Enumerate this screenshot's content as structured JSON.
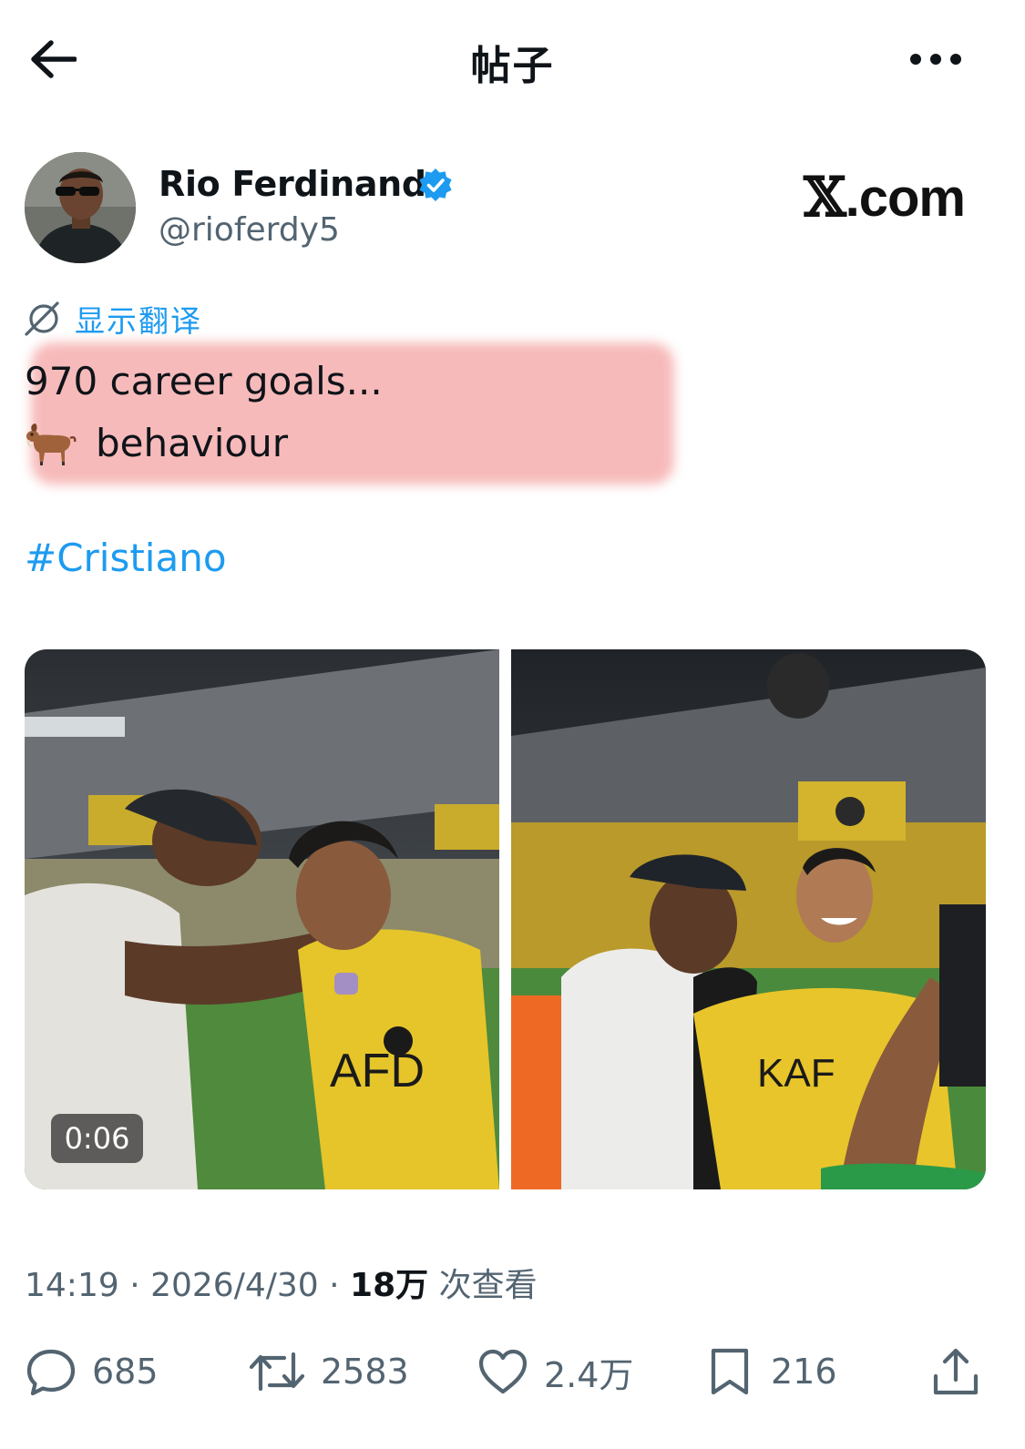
{
  "header": {
    "title": "帖子",
    "back_icon": "arrow-left-icon",
    "more_icon": "more-horizontal-icon"
  },
  "author": {
    "display_name": "Rio Ferdinand",
    "handle": "@rioferdy5",
    "verified": true,
    "verified_color": "#1d9bf0"
  },
  "brand": {
    "x_glyph": "𝕏",
    "domain": ".com"
  },
  "translate": {
    "label": "显示翻译",
    "icon": "translate-icon"
  },
  "tweet": {
    "line1": "970 career goals...",
    "line2": "behaviour",
    "emoji_icon": "goat-icon",
    "hashtag": "#Cristiano",
    "highlight_color": "#f4a0a0"
  },
  "media": {
    "video_duration": "0:06",
    "left_alt_icon": "video-thumbnail",
    "right_alt_icon": "photo-thumbnail"
  },
  "meta": {
    "time": "14:19",
    "separator": " · ",
    "date": "2026/4/30",
    "views_count": "18万",
    "views_label": " 次查看"
  },
  "actions": {
    "replies": "685",
    "reposts": "2583",
    "likes": "2.4万",
    "bookmarks": "216"
  },
  "colors": {
    "accent": "#1d9bf0",
    "secondary_text": "#536471",
    "primary_text": "#0f1419"
  }
}
